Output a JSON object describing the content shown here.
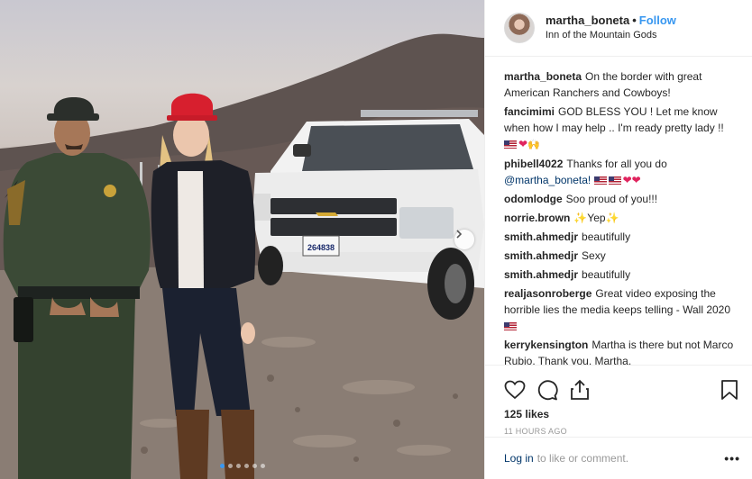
{
  "post": {
    "username": "martha_boneta",
    "separator": "•",
    "follow_label": "Follow",
    "location": "Inn of the Mountain Gods",
    "license_plate": "264838",
    "carousel_dots": 6,
    "carousel_active_index": 0
  },
  "comments": [
    {
      "user": "martha_boneta",
      "text": "On the border with great American Ranchers and Cowboys!"
    },
    {
      "user": "fancimimi",
      "text": "GOD BLESS YOU ! Let me know when how I may help .. I'm ready pretty lady !!",
      "emoji": [
        "flag-us-icon",
        "heart-icon",
        "praise-hands-icon"
      ]
    },
    {
      "user": "phibell4022",
      "text": "Thanks for all you do",
      "mention": "@martha_boneta!",
      "emoji": [
        "flag-us-icon",
        "flag-us-icon",
        "heart-icon",
        "heart-icon"
      ]
    },
    {
      "user": "odomlodge",
      "text": "Soo proud of you!!!"
    },
    {
      "user": "norrie.brown",
      "text": "Yep",
      "emoji": [
        "sparkles-icon",
        "sparkles-icon"
      ]
    },
    {
      "user": "smith.ahmedjr",
      "text": "beautifully"
    },
    {
      "user": "smith.ahmedjr",
      "text": "Sexy"
    },
    {
      "user": "smith.ahmedjr",
      "text": "beautifully"
    },
    {
      "user": "realjasonroberge",
      "text": "Great video exposing the horrible lies the media keeps telling - Wall 2020",
      "emoji": [
        "flag-us-icon"
      ]
    },
    {
      "user": "kerrykensington",
      "text": "Martha is there but not Marco Rubio. Thank you, Martha."
    }
  ],
  "actions": {
    "likes": "125 likes",
    "time": "11 HOURS AGO",
    "icons": [
      "heart-outline-icon",
      "comment-icon",
      "share-icon",
      "bookmark-icon"
    ]
  },
  "footer": {
    "login_label": "Log in",
    "rest_label": "to like or comment.",
    "more_label": "•••"
  },
  "colors": {
    "link_blue": "#3897f0",
    "mention_blue": "#003569",
    "muted_gray": "#999999",
    "border": "#efefef"
  }
}
